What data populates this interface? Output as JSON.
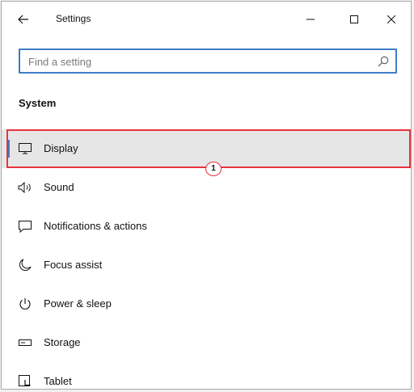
{
  "window": {
    "title": "Settings"
  },
  "icons": {
    "back": "back-arrow-icon",
    "minimize": "minimize-icon",
    "maximize": "maximize-icon",
    "close": "close-icon",
    "search": "search-icon"
  },
  "search": {
    "placeholder": "Find a setting",
    "value": ""
  },
  "section": {
    "title": "System"
  },
  "nav": {
    "items": [
      {
        "label": "Display",
        "icon": "monitor-icon",
        "selected": true
      },
      {
        "label": "Sound",
        "icon": "speaker-icon",
        "selected": false
      },
      {
        "label": "Notifications & actions",
        "icon": "notification-icon",
        "selected": false
      },
      {
        "label": "Focus assist",
        "icon": "moon-icon",
        "selected": false
      },
      {
        "label": "Power & sleep",
        "icon": "power-icon",
        "selected": false
      },
      {
        "label": "Storage",
        "icon": "storage-icon",
        "selected": false
      },
      {
        "label": "Tablet",
        "icon": "tablet-icon",
        "selected": false
      }
    ]
  },
  "annotation": {
    "badge_text": "1",
    "color": "#e8323c"
  },
  "colors": {
    "accent": "#3f7cc7",
    "selected_bg": "#e6e6e6"
  }
}
